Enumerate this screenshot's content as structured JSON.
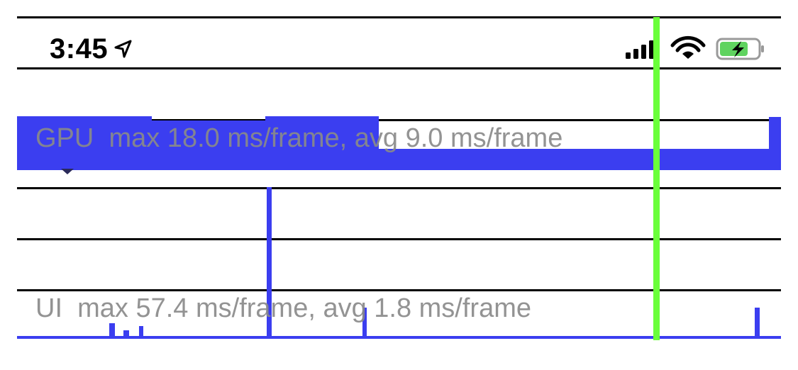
{
  "status_bar": {
    "time": "3:45",
    "location_icon": "location-arrow-icon",
    "signal_icon": "cellular-signal-icon",
    "wifi_icon": "wifi-icon",
    "battery_icon": "battery-charging-icon",
    "battery_level": 0.75
  },
  "gpu_graph": {
    "label": "GPU  max 18.0 ms/frame, avg 9.0 ms/frame",
    "max_ms": 18.0,
    "avg_ms": 9.0
  },
  "ui_graph": {
    "label": "UI  max 57.4 ms/frame, avg 1.8 ms/frame",
    "max_ms": 57.4,
    "avg_ms": 1.8
  },
  "colors": {
    "bar": "#3b3ef0",
    "marker": "#6aff3a",
    "label": "#8a8a8a",
    "line": "#000000",
    "battery_fill": "#5fd35f"
  }
}
